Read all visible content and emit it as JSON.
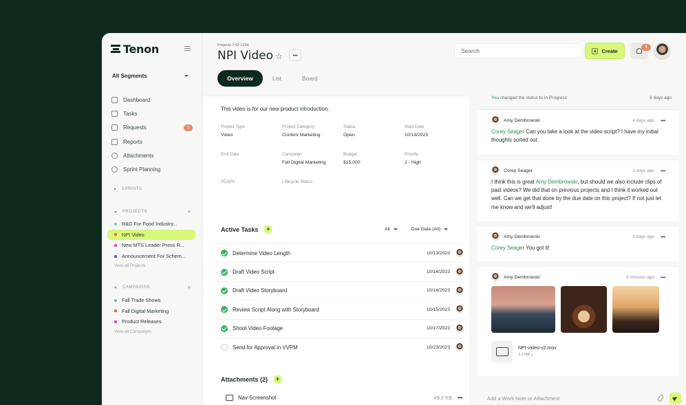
{
  "app": {
    "name": "Tenon"
  },
  "sidebar": {
    "segment": "All Segments",
    "nav": [
      {
        "label": "Dashboard",
        "icon": "grid-icon"
      },
      {
        "label": "Tasks",
        "icon": "checkbox-icon"
      },
      {
        "label": "Requests",
        "icon": "inbox-icon",
        "badge": "1"
      },
      {
        "label": "Reports",
        "icon": "document-icon"
      },
      {
        "label": "Attachments",
        "icon": "paperclip-icon"
      },
      {
        "label": "Sprint Planning",
        "icon": "refresh-icon"
      }
    ],
    "sprints_label": "SPRINTS",
    "projects_label": "PROJECTS",
    "projects": [
      {
        "label": "R&D For Food Industry...",
        "color": "#7fd0c0"
      },
      {
        "label": "NPI Video",
        "color": "#e0732f",
        "active": true
      },
      {
        "label": "New MTS Leader Press R...",
        "color": "#d64fb0"
      },
      {
        "label": "Announcement For Schem...",
        "color": "#5566cc"
      }
    ],
    "view_all_projects": "View all Projects",
    "campaigns_label": "CAMPAIGNS",
    "campaigns": [
      {
        "label": "Fall Trade Shows",
        "color": "#6fc9a8"
      },
      {
        "label": "Fall Digital Marketing",
        "color": "#e0732f"
      },
      {
        "label": "Product Releases",
        "color": "#d64fb0"
      }
    ],
    "view_all_campaigns": "View all Campaigns"
  },
  "header": {
    "breadcrumb": "Projects > ID 1234",
    "title": "NPI Video",
    "more": "•••",
    "tabs": [
      "Overview",
      "List",
      "Board"
    ],
    "search_placeholder": "Search",
    "create_label": "Create",
    "notification_count": "4"
  },
  "overview": {
    "description": "This video is for our new product introduction.",
    "fields": [
      [
        {
          "label": "Project Type",
          "value": "Video"
        },
        {
          "label": "Project Category",
          "value": "Content Marketing"
        },
        {
          "label": "Status",
          "value": "Open"
        },
        {
          "label": "Start Date",
          "value": "10/13/2023"
        }
      ],
      [
        {
          "label": "End Date",
          "value": ""
        },
        {
          "label": "Campaign",
          "value": "Fall Digital Marketing"
        },
        {
          "label": "Budget",
          "value": "$15,000"
        },
        {
          "label": "Priority",
          "value": "2 - High"
        }
      ],
      [
        {
          "label": "PCAP#",
          "value": ""
        },
        {
          "label": "Lifecycle Status",
          "value": ""
        }
      ]
    ]
  },
  "tasks": {
    "title": "Active Tasks",
    "filter_all": "All",
    "filter_due": "Due Date (All)",
    "items": [
      {
        "name": "Determine Video Length",
        "date": "10/13/2023",
        "done": true
      },
      {
        "name": "Draft Video Script",
        "date": "10/14/2023",
        "done": true
      },
      {
        "name": "Draft Video Storyboard",
        "date": "10/14/2023",
        "done": true
      },
      {
        "name": "Review Script Along with Storyboard",
        "date": "10/15/2023",
        "done": true
      },
      {
        "name": "Shoot Video Footage",
        "date": "10/17/2023",
        "done": true
      },
      {
        "name": "Send for Approval in VVPM",
        "date": "10/23/2023",
        "done": false
      }
    ]
  },
  "attachments": {
    "title": "Attachments",
    "count": "(2)",
    "items": [
      {
        "name": "Nav Screenshot",
        "size": "49.2 KB"
      }
    ]
  },
  "activity": {
    "status_prefix": "You",
    "status_text": " changed the status to In Progress",
    "status_time": "6 days ago",
    "messages": [
      {
        "author": "Amy Dembrowski",
        "time": "4 days ago",
        "mention": "Corey Seager",
        "text": " Can you take a look at the video script? I have my initial thoughts sorted out."
      },
      {
        "author": "Corey Seager",
        "time": "3 days ago",
        "pre": "I think this is great ",
        "mention": "Amy Dembrowski",
        "text": ", but should we also include clips of past videos? We did that on previous projects and I think it worked out well. Can we get that done by the due date on this project? If not just let me know and we'll adjust!"
      },
      {
        "author": "Amy Dembrowski",
        "time": "3 days ago",
        "mention": "Corey Seager",
        "text": " You got it!"
      },
      {
        "author": "Amy Dembrowski",
        "time": "4 minutes ago",
        "file_name": "NPI-video-v2.mov",
        "file_size": "3.2 MB"
      }
    ],
    "composer_placeholder": "Add a Work Note or Attachment"
  }
}
